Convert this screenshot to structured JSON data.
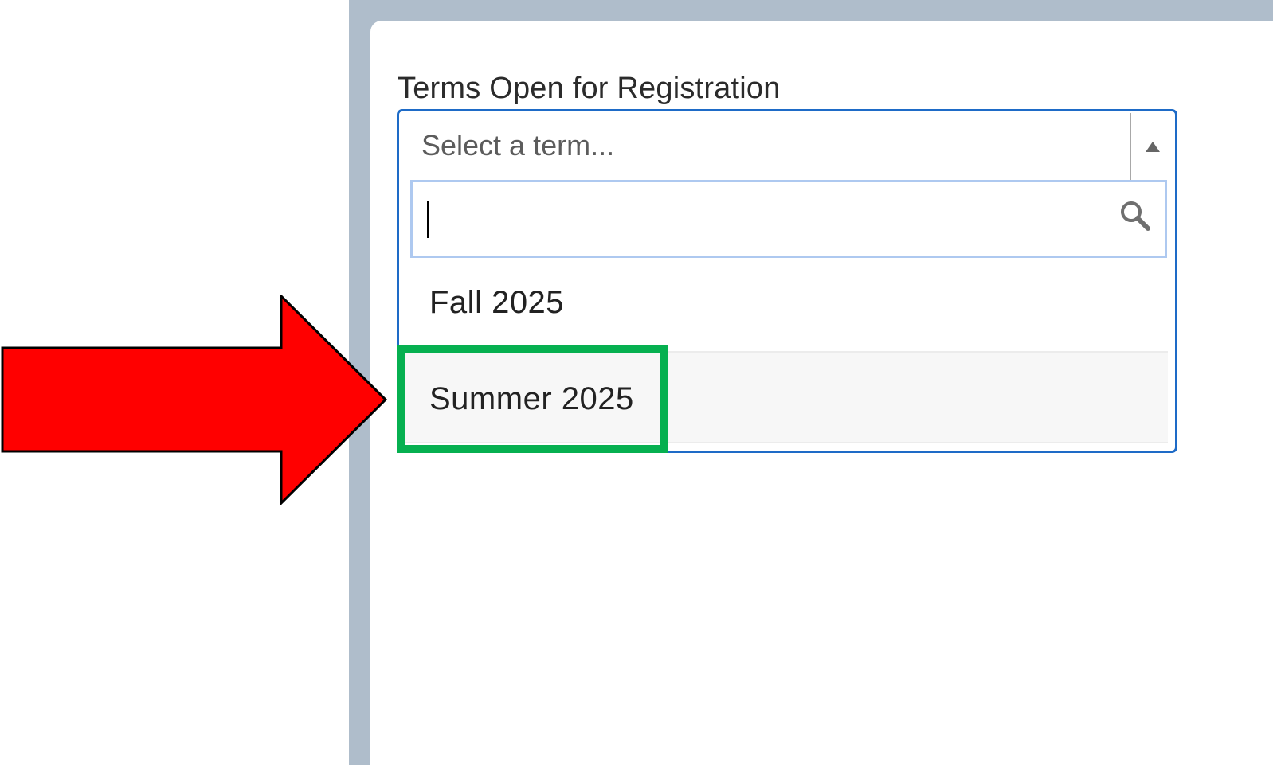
{
  "field": {
    "label": "Terms Open for Registration",
    "placeholder": "Select a term...",
    "search_value": ""
  },
  "options": [
    {
      "label": "Fall 2025"
    },
    {
      "label": "Summer 2025"
    }
  ],
  "icons": {
    "caret": "caret-up-icon",
    "search": "search-icon",
    "annotation_arrow": "red-arrow"
  },
  "colors": {
    "frame": "#afbdcb",
    "select_border": "#1e6bc7",
    "search_border": "#aec9f0",
    "highlight_border": "#06b050",
    "arrow_fill": "#ff0000",
    "hover_option_bg": "#f7f7f7"
  }
}
